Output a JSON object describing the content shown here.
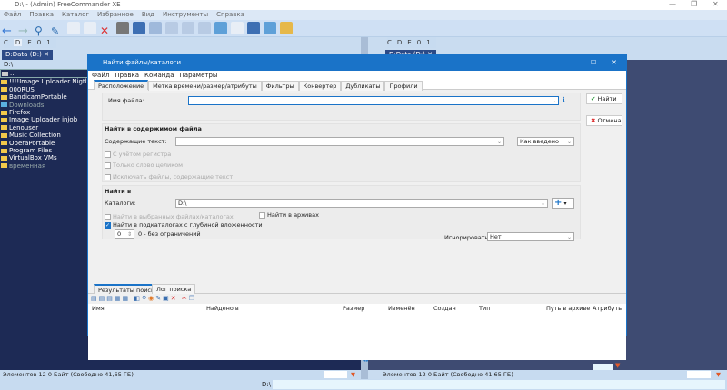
{
  "app": {
    "title": "D:\\ - (Admin) FreeCommander XE"
  },
  "menu": [
    "Файл",
    "Правка",
    "Каталог",
    "Избранное",
    "Вид",
    "Инструменты",
    "Справка"
  ],
  "drives": [
    "C",
    "D",
    "E",
    "0",
    "1"
  ],
  "left_pane": {
    "tab": "D:Data (D:)",
    "path": "D:\\",
    "items": [
      "..",
      "!!!!Image Uploader Nigtly!!!!",
      "000RUS",
      "BandicamPortable",
      "Downloads",
      "Firefox",
      "Image Uploader injob",
      "Lenouser",
      "Music Collection",
      "OperaPortable",
      "Program Files",
      "VirtualBox VMs",
      "временная"
    ],
    "status": "Элементов 12   0 Байт   (Свободно 41,65 ГБ)"
  },
  "right_pane": {
    "tab": "D:Data (D:)",
    "status": "Элементов 12   0 Байт   (Свободно 41,65 ГБ)"
  },
  "bottom": {
    "path_label": "D:\\",
    "command_value": ""
  },
  "dialog": {
    "title": "Найти файлы/каталоги",
    "menu": [
      "Файл",
      "Правка",
      "Команда",
      "Параметры"
    ],
    "tabs": [
      "Расположение",
      "Метка времени/размер/атрибуты",
      "Фильтры",
      "Конвертер",
      "Дубликаты",
      "Профили"
    ],
    "filename_label": "Имя файла:",
    "filename_value": "",
    "content_group": "Найти в содержимом файла",
    "content_label": "Содержащие текст:",
    "content_value": "",
    "case_mode": "Как введено",
    "opt_case": "С учётом регистра",
    "opt_whole": "Только слово целиком",
    "opt_exclude": "Исключать файлы, содержащие текст",
    "find_in_group": "Найти в",
    "folders_label": "Каталоги:",
    "folders_value": "D:\\",
    "opt_selected": "Найти в выбранных файлах/каталогах",
    "opt_archives": "Найти в архивах",
    "opt_subdirs": "Найти в подкаталогах с глубиной вложенности",
    "depth": "0",
    "depth_hint": "0 - без ограничений",
    "ignore_label": "Игнорировать:",
    "ignore_value": "Нет",
    "find_button": "Найти",
    "cancel_button": "Отмена",
    "result_tabs": [
      "Результаты поиска",
      "Лог поиска"
    ],
    "columns": [
      "Имя",
      "Найдено в",
      "Размер",
      "Изменён",
      "Создан",
      "Тип",
      "Путь в архиве",
      "Атрибуты"
    ]
  },
  "colors": {
    "accent": "#1a73c8",
    "pane_dark": "#1d2a55"
  }
}
